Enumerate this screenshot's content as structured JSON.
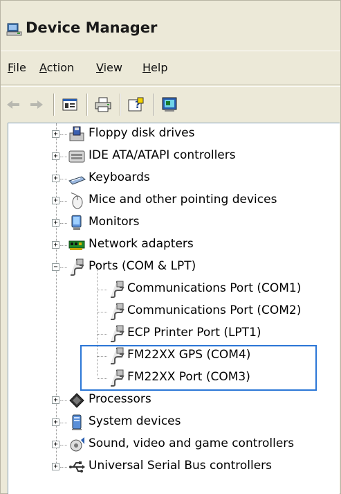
{
  "window": {
    "title": "Device Manager"
  },
  "menu": [
    {
      "label": "File",
      "accel": "F",
      "rest": "ile"
    },
    {
      "label": "Action",
      "accel": "A",
      "rest": "ction"
    },
    {
      "label": "View",
      "accel": "V",
      "rest": "iew"
    },
    {
      "label": "Help",
      "accel": "H",
      "rest": "elp"
    }
  ],
  "toolbar": [
    "back-icon",
    "forward-icon",
    "properties-icon",
    "print-icon",
    "help-icon",
    "scan-hardware-icon"
  ],
  "tree": [
    {
      "label": "Floppy disk drives",
      "level": 0,
      "expander": "+",
      "icon": "floppy-drive-icon"
    },
    {
      "label": "IDE ATA/ATAPI controllers",
      "level": 0,
      "expander": "+",
      "icon": "ide-controller-icon"
    },
    {
      "label": "Keyboards",
      "level": 0,
      "expander": "+",
      "icon": "keyboard-icon"
    },
    {
      "label": "Mice and other pointing devices",
      "level": 0,
      "expander": "+",
      "icon": "mouse-icon"
    },
    {
      "label": "Monitors",
      "level": 0,
      "expander": "+",
      "icon": "monitor-icon"
    },
    {
      "label": "Network adapters",
      "level": 0,
      "expander": "+",
      "icon": "network-adapter-icon"
    },
    {
      "label": "Ports (COM & LPT)",
      "level": 0,
      "expander": "−",
      "icon": "port-icon"
    },
    {
      "label": "Communications Port (COM1)",
      "level": 1,
      "icon": "port-icon"
    },
    {
      "label": "Communications Port (COM2)",
      "level": 1,
      "icon": "port-icon"
    },
    {
      "label": "ECP Printer Port (LPT1)",
      "level": 1,
      "icon": "port-icon"
    },
    {
      "label": "FM22XX GPS (COM4)",
      "level": 1,
      "icon": "port-icon"
    },
    {
      "label": "FM22XX Port (COM3)",
      "level": 1,
      "icon": "port-icon"
    },
    {
      "label": "Processors",
      "level": 0,
      "expander": "+",
      "icon": "processor-icon"
    },
    {
      "label": "System devices",
      "level": 0,
      "expander": "+",
      "icon": "system-devices-icon"
    },
    {
      "label": "Sound, video and game controllers",
      "level": 0,
      "expander": "+",
      "icon": "sound-icon"
    },
    {
      "label": "Universal Serial Bus controllers",
      "level": 0,
      "expander": "+",
      "icon": "usb-icon"
    }
  ],
  "colors": {
    "highlight": "#2b76d6",
    "window_bg": "#ece9d8"
  }
}
